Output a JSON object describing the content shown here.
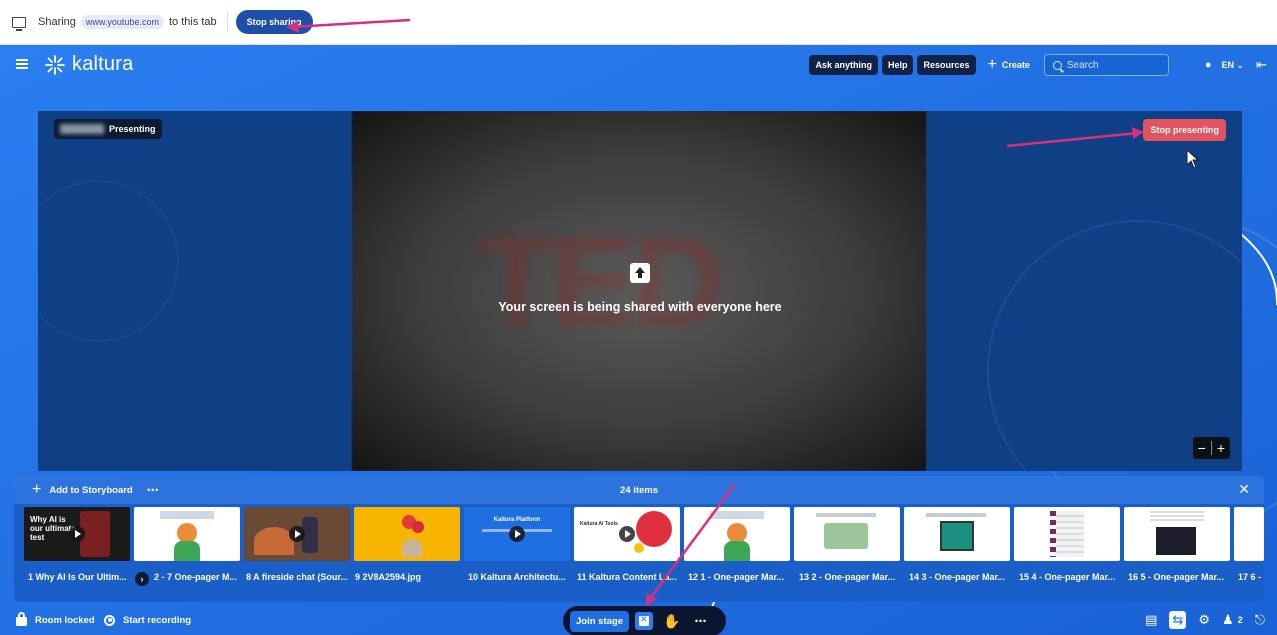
{
  "share_bar": {
    "sharing_prefix": "Sharing",
    "domain": "www.youtube.com",
    "sharing_suffix": "to this tab",
    "stop_sharing": "Stop sharing"
  },
  "nav": {
    "logo_text": "kaltura",
    "ask_anything": "Ask anything",
    "help": "Help",
    "resources": "Resources",
    "create": "Create",
    "search_placeholder": "Search",
    "language": "EN"
  },
  "stage": {
    "presenting_label": "Presenting",
    "stop_presenting": "Stop presenting",
    "share_message": "Your screen is being shared with everyone here"
  },
  "storyboard": {
    "add_label": "Add to Storyboard",
    "items_count": "24 items",
    "items": [
      {
        "label": "1 Why AI Is Our Ultim...",
        "thumb_text": "Why AI is our ultimate test"
      },
      {
        "label": "2 - 7 One-pager M..."
      },
      {
        "label": "8 A fireside chat (Sour..."
      },
      {
        "label": "9 2V8A2594.jpg"
      },
      {
        "label": "10 Kaltura Architectu...",
        "thumb_text": "Kaltura Platform"
      },
      {
        "label": "11 Kaltura Content La...",
        "thumb_text": "Kaltura AI Tools"
      },
      {
        "label": "12 1 - One-pager Mar..."
      },
      {
        "label": "13 2 - One-pager Mar..."
      },
      {
        "label": "14 3 - One-pager Mar..."
      },
      {
        "label": "15 4 - One-pager Mar..."
      },
      {
        "label": "16 5 - One-pager Mar..."
      },
      {
        "label": "17 6 - ("
      }
    ]
  },
  "bottom": {
    "room_locked": "Room locked",
    "start_recording": "Start recording",
    "join_stage": "Join stage",
    "participants": "2"
  },
  "colors": {
    "brand_blue": "#1b70e8",
    "dark_navy": "#0a1530",
    "stop_red": "#e2525f",
    "annotation_pink": "#d6307f"
  }
}
